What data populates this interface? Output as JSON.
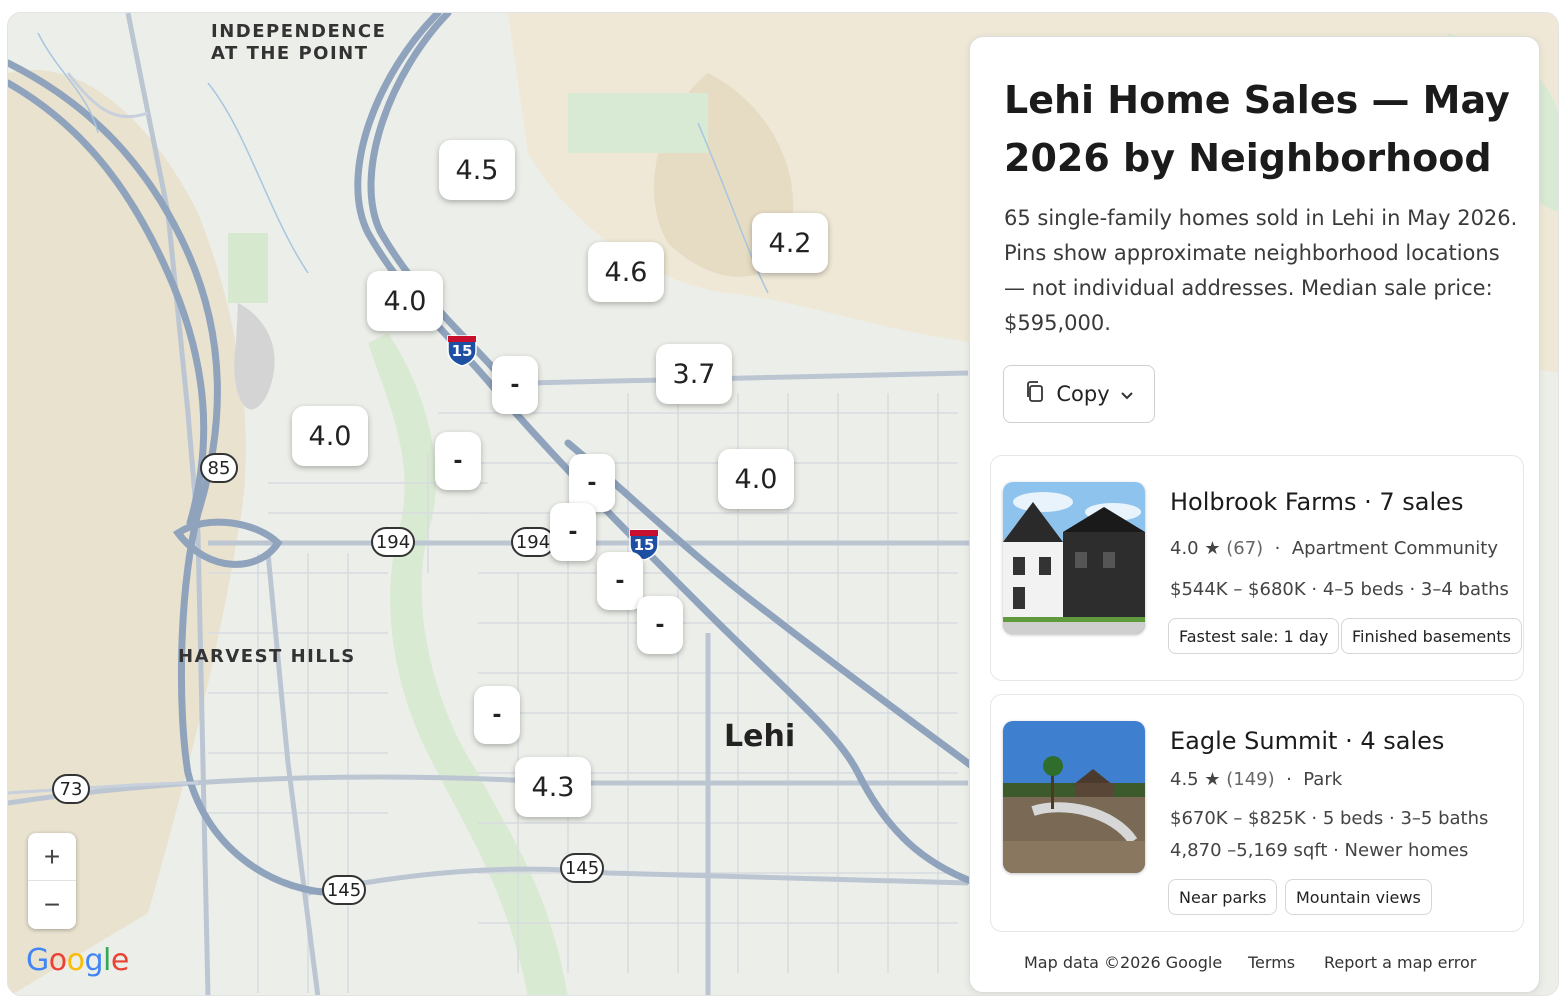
{
  "map": {
    "area_labels": {
      "independence_line1": "INDEPENDENCE",
      "independence_line2": "AT THE POINT",
      "harvest_hills": "HARVEST HILLS"
    },
    "city_label": "Lehi",
    "route_shields": {
      "r85": "85",
      "r194_a": "194",
      "r194_b": "194",
      "r73": "73",
      "r145_a": "145",
      "r145_b": "145",
      "i15_a": "15",
      "i15_b": "15"
    },
    "pins": {
      "p1": "4.5",
      "p2": "4.2",
      "p3": "4.6",
      "p4": "4.0",
      "p5": "3.7",
      "p6": "4.0",
      "p7": "4.0",
      "p8": "4.3",
      "d1": "-",
      "d2": "-",
      "d3": "-",
      "d4": "-",
      "d5": "-",
      "d6": "-",
      "d7": "-"
    },
    "zoom": {
      "in": "+",
      "out": "−"
    },
    "logo": {
      "G": "G",
      "o1": "o",
      "o2": "o",
      "g": "g",
      "l": "l",
      "e": "e"
    },
    "logo_colors": {
      "blue": "#4285F4",
      "red": "#EA4335",
      "yellow": "#FBBC05",
      "green": "#34A853"
    }
  },
  "panel": {
    "title": "Lehi Home Sales — May 2026 by Neighborhood",
    "description": "65 single-family homes sold in Lehi in May 2026. Pins show approximate neighborhood locations — not individual addresses. Median sale price: $595,000.",
    "copy_button": "Copy",
    "listings": [
      {
        "name": "Holbrook Farms",
        "sales": "7 sales",
        "rating": "4.0",
        "reviews": "(67)",
        "category": "Apartment Community",
        "details": "$544K – $680K · 4–5 beds · 3–4 baths",
        "details2": "",
        "tags": [
          "Fastest sale: 1 day",
          "Finished basements"
        ]
      },
      {
        "name": "Eagle Summit",
        "sales": "4 sales",
        "rating": "4.5",
        "reviews": "(149)",
        "category": "Park",
        "details": "$670K – $825K · 5 beds · 3–5 baths",
        "details2": "4,870 –5,169 sqft · Newer homes",
        "tags": [
          "Near parks",
          "Mountain views"
        ]
      }
    ],
    "footer": {
      "map_data": "Map data ©2026 Google",
      "terms": "Terms",
      "report": "Report a map error"
    }
  }
}
